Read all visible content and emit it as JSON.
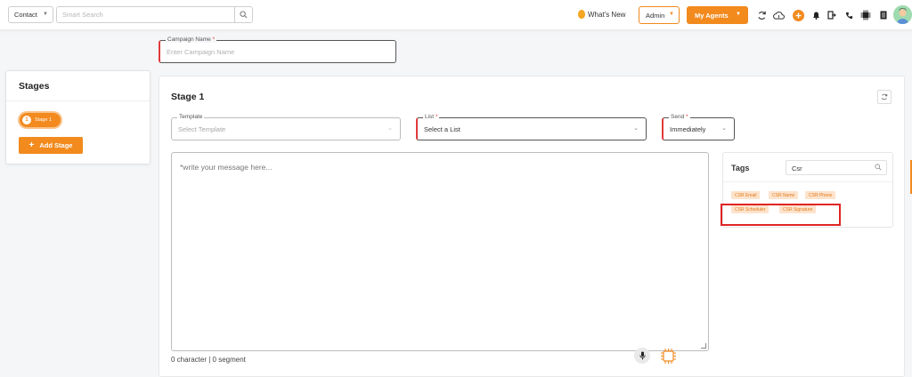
{
  "topbar": {
    "context_select": "Contact",
    "search_placeholder": "Smart Search",
    "whats_new": "What's New",
    "role_select": "Admin",
    "agents_button": "My Agents"
  },
  "campaign": {
    "name_label": "Campaign Name",
    "name_placeholder": "Enter Campaign Name"
  },
  "stages_panel": {
    "title": "Stages",
    "stage_number": "1",
    "stage_label": "Stage 1",
    "add_stage": "Add Stage"
  },
  "stage": {
    "title": "Stage 1",
    "template_label": "Template",
    "template_placeholder": "Select Template",
    "list_label": "List",
    "list_placeholder": "Select a List",
    "send_label": "Send",
    "send_value": "Immediately",
    "message_placeholder": "*write your message here...",
    "counter": "0 character | 0 segment"
  },
  "tags_panel": {
    "title": "Tags",
    "search_value": "Csr",
    "chips": [
      "CSR Email",
      "CSR Name",
      "CSR Phone",
      "CSR Scheduler",
      "CSR Signature"
    ]
  },
  "colors": {
    "accent": "#f28a1e",
    "required": "#e03a3a",
    "highlight": "#e02424"
  }
}
